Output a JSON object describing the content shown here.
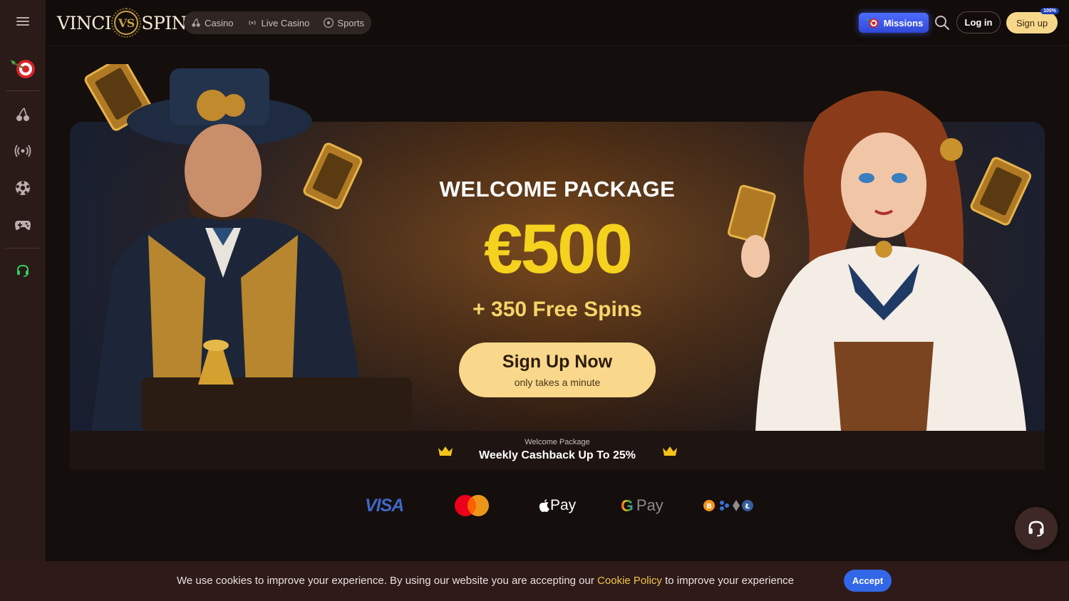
{
  "header": {
    "logo_left": "VINCI",
    "logo_mid": "VS",
    "logo_right": "SPIN",
    "nav": [
      {
        "label": "Casino",
        "icon": "cherries-icon"
      },
      {
        "label": "Live Casino",
        "icon": "broadcast-icon"
      },
      {
        "label": "Sports",
        "icon": "football-icon"
      }
    ],
    "missions_label": "Missions",
    "login_label": "Log in",
    "signup_label": "Sign up",
    "signup_badge": "100%"
  },
  "sidebar": {
    "items": [
      {
        "icon": "menu-icon"
      },
      {
        "icon": "dart-target-icon"
      },
      {
        "icon": "cherries-icon"
      },
      {
        "icon": "broadcast-icon"
      },
      {
        "icon": "football-icon"
      },
      {
        "icon": "gamepad-icon"
      },
      {
        "icon": "headset-icon"
      }
    ]
  },
  "banner": {
    "title": "WELCOME PACKAGE",
    "amount": "€500",
    "spins": "+ 350 Free Spins",
    "cta_main": "Sign Up Now",
    "cta_sub": "only takes a minute"
  },
  "strip": {
    "label": "Welcome Package",
    "title": "Weekly Cashback Up To 25%"
  },
  "payments": {
    "visa": "VISA",
    "apple": "Pay",
    "gpay": "Pay"
  },
  "cookie": {
    "text_before": "We use cookies to improve your experience. By using our website you are accepting our ",
    "link": "Cookie Policy",
    "text_after": " to improve your experience",
    "accept": "Accept"
  },
  "colors": {
    "accent_gold": "#f4d21e",
    "cta_bg": "#f9d88c",
    "missions_blue": "#3148d6",
    "accept_blue": "#3267e8"
  }
}
